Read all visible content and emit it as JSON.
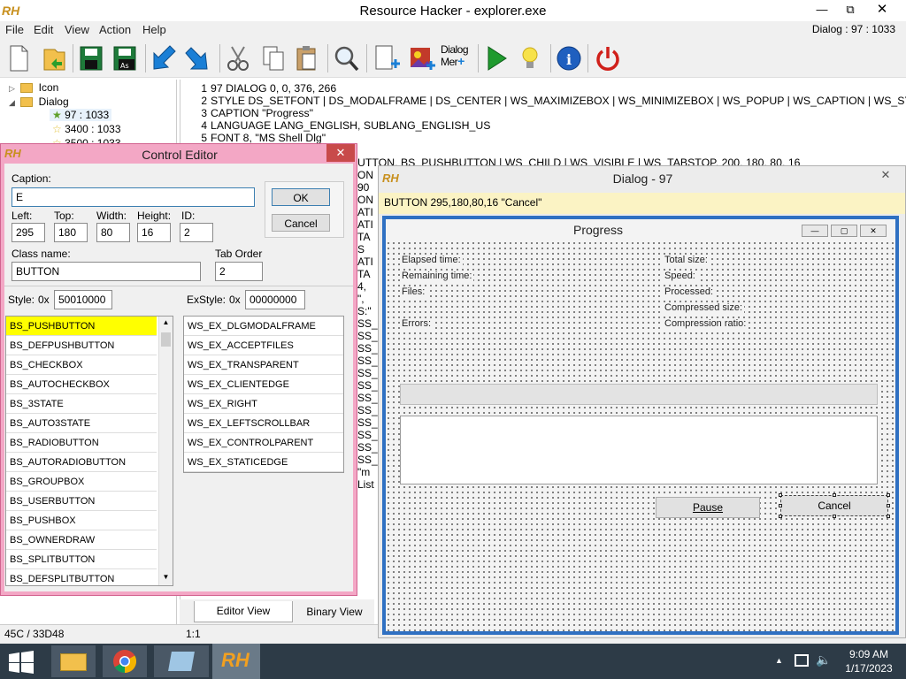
{
  "window": {
    "title": "Resource Hacker - explorer.exe",
    "logo": "RH",
    "controls": [
      "—",
      "⧉",
      "✕"
    ]
  },
  "menu": {
    "items": [
      "File",
      "Edit",
      "View",
      "Action",
      "Help"
    ],
    "right_info": "Dialog : 97 : 1033"
  },
  "toolbar": {
    "dialog_menu_label_line1": "Dialog",
    "dialog_menu_label_line2": "Mer",
    "icons": [
      "new-file-icon",
      "open-icon",
      "save-icon",
      "save-as-icon",
      "back-icon",
      "forward-icon",
      "cut-icon",
      "copy-icon",
      "paste-icon",
      "find-icon",
      "add-resource-icon",
      "add-image-icon",
      "dialog-merge-icon",
      "run-icon",
      "lightbulb-icon",
      "info-icon",
      "power-icon"
    ]
  },
  "tree": {
    "items": [
      {
        "label": "Icon",
        "expander": "▷"
      },
      {
        "label": "Dialog",
        "expander": "◢"
      },
      {
        "label": "97 : 1033"
      },
      {
        "label": "3400 : 1033"
      },
      {
        "label": "3500 : 1033"
      }
    ]
  },
  "code": {
    "lines": [
      {
        "n": "1",
        "text": "97 DIALOG 0, 0, 376, 266"
      },
      {
        "n": "2",
        "text": "STYLE DS_SETFONT | DS_MODALFRAME | DS_CENTER | WS_MAXIMIZEBOX | WS_MINIMIZEBOX | WS_POPUP | WS_CAPTION | WS_SYSME"
      },
      {
        "n": "3",
        "text": "CAPTION \"Progress\""
      },
      {
        "n": "4",
        "text": "LANGUAGE LANG_ENGLISH, SUBLANG_ENGLISH_US"
      },
      {
        "n": "5",
        "text": "FONT 8, \"MS Shell Dlg\""
      }
    ],
    "partial_line": "UTTON, BS_PUSHBUTTON | WS_CHILD | WS_VISIBLE | WS_TABSTOP, 200, 180, 80, 16",
    "fragments": [
      "ON",
      "90",
      "ON",
      "ATI",
      "ATI",
      "TA",
      "S",
      "ATI",
      "TA",
      "4,",
      "\",",
      "S:\"",
      "SS_",
      "SS_",
      "SS_",
      "SS_",
      "SS_",
      "SS_",
      "SS_",
      "SS_",
      "SS_",
      "SS_",
      "SS_",
      "SS_",
      "\"m",
      "List"
    ]
  },
  "tabs": {
    "editor": "Editor View",
    "binary": "Binary View"
  },
  "status": {
    "left": "45C / 33D48",
    "position": "1:1"
  },
  "control_editor": {
    "title": "Control Editor",
    "caption_label": "Caption:",
    "caption_value": "E",
    "ok": "OK",
    "cancel": "Cancel",
    "left_label": "Left:",
    "left": "295",
    "top_label": "Top:",
    "top": "180",
    "width_label": "Width:",
    "width": "80",
    "height_label": "Height:",
    "height": "16",
    "id_label": "ID:",
    "id": "2",
    "class_label": "Class name:",
    "class_value": "BUTTON",
    "tab_order_label": "Tab Order",
    "tab_order": "2",
    "style_label": "Style:",
    "style_prefix": "0x",
    "style_value": "50010000",
    "exstyle_label": "ExStyle:",
    "exstyle_prefix": "0x",
    "exstyle_value": "00000000",
    "styles": [
      "BS_PUSHBUTTON",
      "BS_DEFPUSHBUTTON",
      "BS_CHECKBOX",
      "BS_AUTOCHECKBOX",
      "BS_3STATE",
      "BS_AUTO3STATE",
      "BS_RADIOBUTTON",
      "BS_AUTORADIOBUTTON",
      "BS_GROUPBOX",
      "BS_USERBUTTON",
      "BS_PUSHBOX",
      "BS_OWNERDRAW",
      "BS_SPLITBUTTON",
      "BS_DEFSPLITBUTTON"
    ],
    "exstyles": [
      "WS_EX_DLGMODALFRAME",
      "WS_EX_ACCEPTFILES",
      "WS_EX_TRANSPARENT",
      "WS_EX_CLIENTEDGE",
      "WS_EX_RIGHT",
      "WS_EX_LEFTSCROLLBAR",
      "WS_EX_CONTROLPARENT",
      "WS_EX_STATICEDGE"
    ]
  },
  "dialog_preview": {
    "title": "Dialog - 97",
    "info": "BUTTON  295,180,80,16  \"Cancel\"",
    "progress_title": "Progress",
    "left_labels": [
      "Elapsed time:",
      "Remaining time:",
      "Files:",
      "Errors:"
    ],
    "right_labels": [
      "Total size:",
      "Speed:",
      "Processed:",
      "Compressed size:",
      "Compression ratio:"
    ],
    "pause": "Pause",
    "cancel": "Cancel"
  },
  "taskbar": {
    "time": "9:09 AM",
    "date": "1/17/2023",
    "apps": [
      "file-explorer-icon",
      "chrome-icon",
      "notepad-icon",
      "resource-hacker-icon"
    ]
  }
}
